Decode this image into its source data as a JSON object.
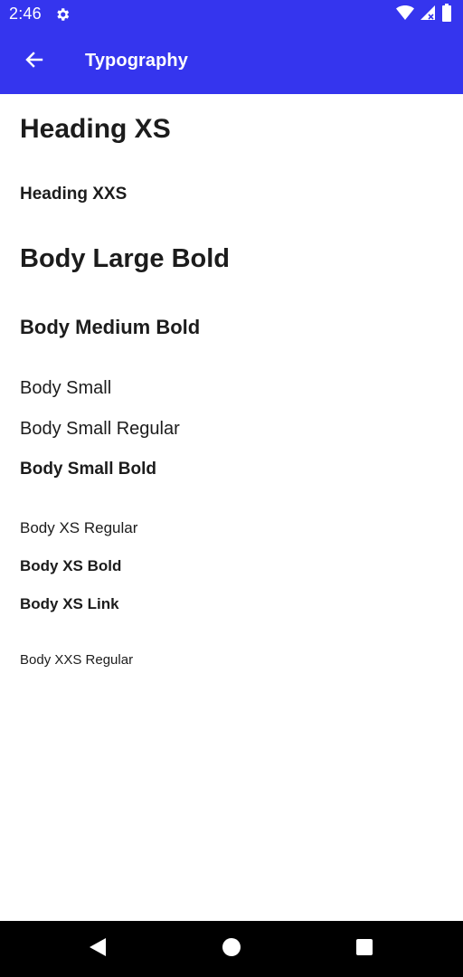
{
  "status_bar": {
    "time": "2:46",
    "icons": [
      "gear-icon",
      "wifi-icon",
      "signal-icon",
      "battery-icon"
    ]
  },
  "app_bar": {
    "title": "Typography",
    "back_icon": "arrow-left-icon",
    "background": "#3535ee"
  },
  "samples": {
    "heading_xs": "Heading XS",
    "heading_xxs": "Heading XXS",
    "body_large_bold": "Body Large Bold",
    "body_medium_bold": "Body Medium Bold",
    "body_small": "Body Small",
    "body_small_regular": "Body Small Regular",
    "body_small_bold": "Body Small Bold",
    "body_xs_regular": "Body XS Regular",
    "body_xs_bold": "Body XS Bold",
    "body_xs_link": "Body XS Link",
    "body_xxs_regular": "Body XXS Regular"
  },
  "nav_bar": {
    "icons": [
      "back-triangle-icon",
      "home-circle-icon",
      "recents-square-icon"
    ]
  }
}
